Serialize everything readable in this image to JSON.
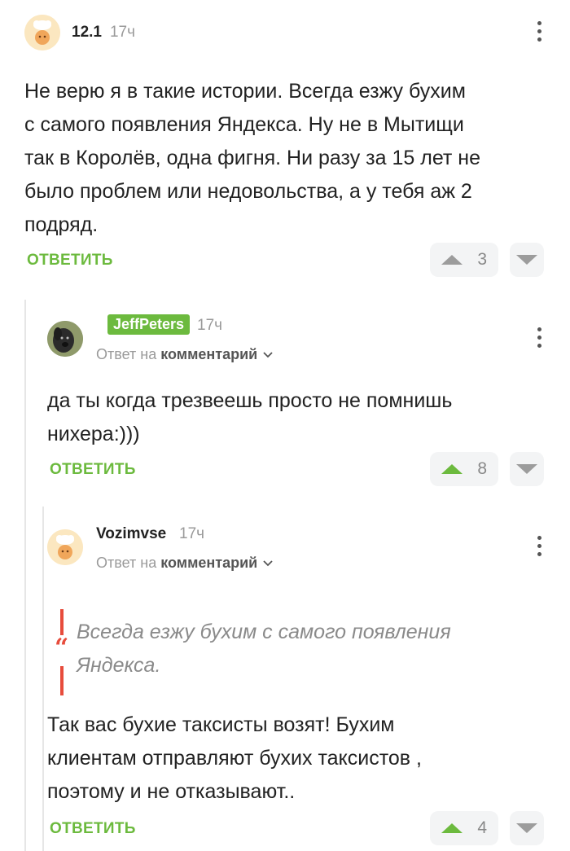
{
  "comments": [
    {
      "username": "12.1",
      "time": "17ч",
      "avatar_icon": "chef-avatar",
      "text_lines": [
        "Не верю я в такие истории. Всегда езжу бухим",
        "с самого появления Яндекса. Ну не в Мытищи",
        "так в Королёв, одна фигня. Ни разу за 15 лет не",
        "было проблем или недовольства, а у тебя аж 2",
        "подряд."
      ],
      "reply_label": "ОТВЕТИТЬ",
      "votes": "3",
      "voted_up": false
    },
    {
      "username": "JeffPeters",
      "time": "17ч",
      "avatar_icon": "dog-avatar",
      "reply_prefix": "Ответ на",
      "reply_target": "комментарий",
      "text_lines": [
        "да ты когда трезвеешь просто не помнишь",
        "нихера:)))"
      ],
      "reply_label": "ОТВЕТИТЬ",
      "votes": "8",
      "voted_up": true
    },
    {
      "username": "Vozimvse",
      "time": "17ч",
      "avatar_icon": "chef-avatar",
      "reply_prefix": "Ответ на",
      "reply_target": "комментарий",
      "quote_lines": [
        "Всегда езжу бухим с самого появления",
        "Яндекса."
      ],
      "text_lines": [
        "Так вас бухие таксисты возят! Бухим",
        "клиентам отправляют бухих таксистов ,",
        "поэтому и не отказывают.."
      ],
      "reply_label": "ОТВЕТИТЬ",
      "votes": "4",
      "voted_up": true
    }
  ],
  "colors": {
    "accent_green": "#6cba3e",
    "quote_red": "#e74c3c",
    "muted": "#9a9a9a"
  }
}
